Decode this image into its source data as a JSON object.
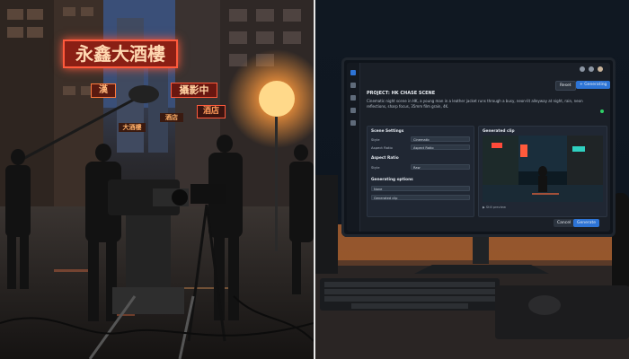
{
  "street_signs": {
    "big": "永鑫大酒樓",
    "sign2": "漢",
    "sign3": "攝影中",
    "sign4": "酒店",
    "sign5": "酒店",
    "sign6": "大酒樓"
  },
  "app": {
    "reset_label": "Reset",
    "generate_top_label": "+ Generating",
    "project_title": "PROJECT: HK CHASE SCENE",
    "prompt": "Cinematic night scene in HK, a young man in a leather jacket runs through a busy, neon-lit alleyway at night, rain, neon reflections, sharp focus, 35mm film grain, 4K.",
    "scene_settings": {
      "heading": "Scene Settings",
      "style_label": "Style",
      "style_value": "Cinematic",
      "aspect_label": "Aspect Ratio",
      "aspect_value": "Aspect Ratio"
    },
    "aspect_section": {
      "heading": "Aspect Ratio",
      "style_label": "Style",
      "style_value": "Raw"
    },
    "generating_options": {
      "heading": "Generating options",
      "option1": "None",
      "option2": "Generated clip"
    },
    "generated_clip": {
      "heading": "Generated clip",
      "preview_label": "▶  Still preview"
    },
    "cancel_label": "Cancel",
    "generate_label": "Generate"
  },
  "colors": {
    "neon_red": "#ff5a3c",
    "neon_orange": "#ff9a3d",
    "accent_blue": "#2d74d6",
    "desk_glow": "#ff8a3a"
  }
}
